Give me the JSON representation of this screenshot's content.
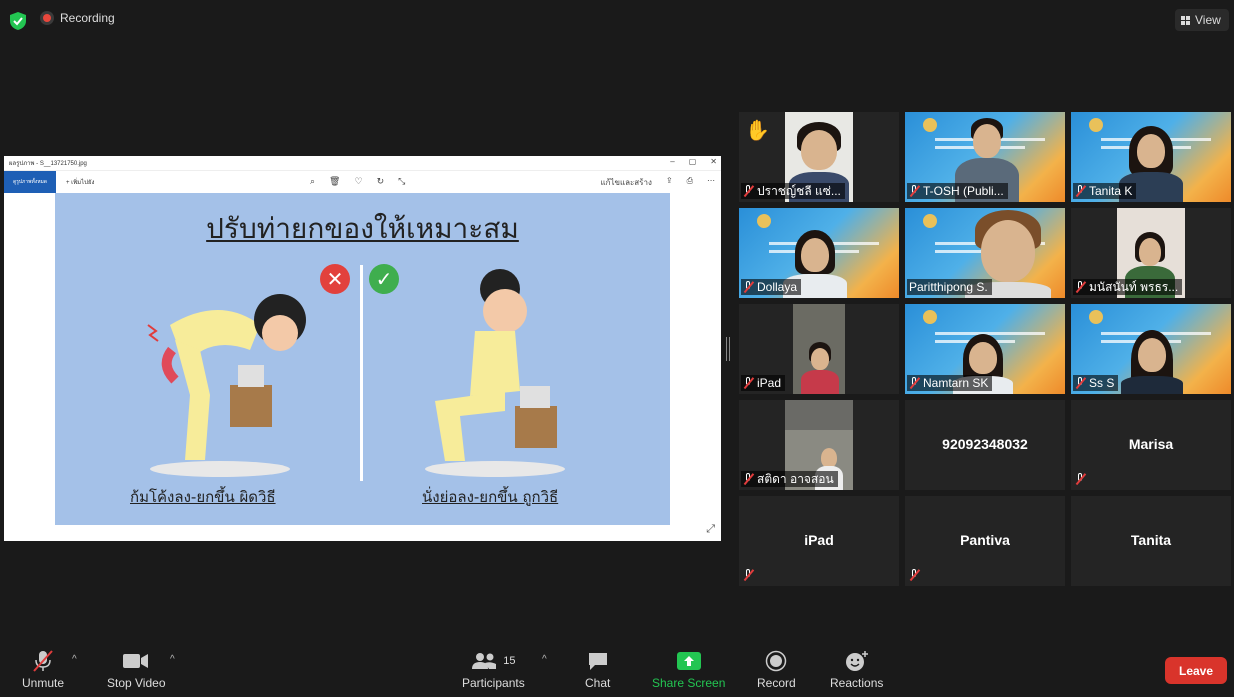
{
  "top": {
    "recording_label": "Recording",
    "view_label": "View"
  },
  "shared_screen": {
    "window_title": "ผลรูปภาพ - S__13721750.jpg",
    "toolbar_left": "ดูรูปภาพทั้งหมด",
    "add_label": "เพิ่มไปยัง",
    "edit_label": "แก้ไขและสร้าง",
    "poster_title": "ปรับท่ายกของให้เหมาะสม",
    "wrong_caption": "ก้มโค้งลง-ยกขึ้น ผิดวิธี",
    "right_caption": "นั่งย่อลง-ยกขึ้น ถูกวิธี"
  },
  "participants": [
    {
      "name": "ปราชญ์ชลี แซ่...",
      "video": true,
      "muted": true,
      "hand_raised": true
    },
    {
      "name": "T-OSH (Publi...",
      "video": true,
      "muted": true
    },
    {
      "name": "Tanita K",
      "video": true,
      "muted": true
    },
    {
      "name": "Dollaya",
      "video": true,
      "muted": true
    },
    {
      "name": "Paritthipong S.",
      "video": true,
      "muted": false,
      "active_speaker": true
    },
    {
      "name": "มนัสนันท์ พรธร...",
      "video": true,
      "muted": true
    },
    {
      "name": "iPad",
      "video": true,
      "muted": true
    },
    {
      "name": "Namtarn SK",
      "video": true,
      "muted": true
    },
    {
      "name": "Ss S",
      "video": true,
      "muted": true
    },
    {
      "name": "สติดา อาจสอน",
      "video": true,
      "muted": true
    },
    {
      "name": "92092348032",
      "video": false,
      "muted": false
    },
    {
      "name": "Marisa",
      "video": false,
      "muted": true
    },
    {
      "name": "iPad",
      "video": false,
      "muted": true
    },
    {
      "name": "Pantiva",
      "video": false,
      "muted": true
    },
    {
      "name": "Tanita",
      "video": false,
      "muted": false
    }
  ],
  "toolbar": {
    "unmute": "Unmute",
    "stop_video": "Stop Video",
    "participants": "Participants",
    "participants_count": "15",
    "chat": "Chat",
    "share_screen": "Share Screen",
    "record": "Record",
    "reactions": "Reactions",
    "leave": "Leave"
  },
  "colors": {
    "background": "#1a1a1a",
    "share_green": "#23c552",
    "leave_red": "#d9342b",
    "speaker_outline": "#c9d94b"
  }
}
